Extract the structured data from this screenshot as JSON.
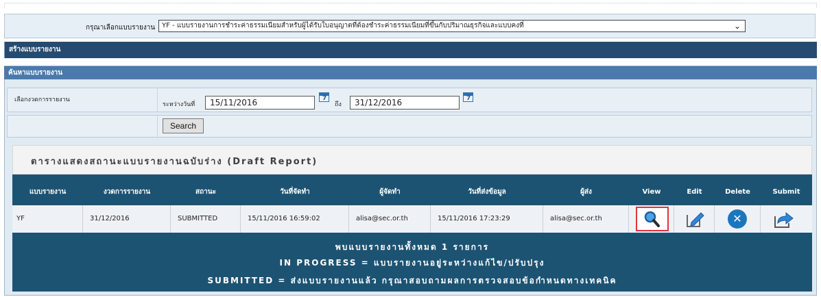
{
  "report_type": {
    "label": "กรุณาเลือกแบบรายงาน",
    "selected": "YF - แบบรายงานการชำระค่าธรรมเนียมสำหรับผู้ได้รับใบอนุญาตที่ต้องชำระค่าธรรมเนียมที่ขึ้นกับปริมาณธุรกิจและแบบคงที่"
  },
  "sections": {
    "create": "สร้างแบบรายงาน",
    "search": "ค้นหาแบบรายงาน"
  },
  "filters": {
    "period_label": "เลือกงวดการรายงาน",
    "between_label": "ระหว่างวันที่",
    "date_from": "15/11/2016",
    "to_label": "ถึง",
    "date_to": "31/12/2016",
    "search_button": "Search"
  },
  "draft_table": {
    "title": "ตารางแสดงสถานะแบบรายงานฉบับร่าง (Draft Report)",
    "columns": [
      "แบบรายงาน",
      "งวดการรายงาน",
      "สถานะ",
      "วันที่จัดทำ",
      "ผู้จัดทำ",
      "วันที่ส่งข้อมูล",
      "ผู้ส่ง",
      "View",
      "Edit",
      "Delete",
      "Submit"
    ],
    "rows": [
      {
        "report": "YF",
        "period": "31/12/2016",
        "status": "SUBMITTED",
        "created_date": "15/11/2016 16:59:02",
        "created_by": "alisa@sec.or.th",
        "submitted_date": "15/11/2016 17:23:29",
        "submitted_by": "alisa@sec.or.th"
      }
    ],
    "summary": "พบแบบรายงานทั้งหมด 1 รายการ",
    "legend_in_progress": "IN PROGRESS = แบบรายงานอยู่ระหว่างแก้ไข/ปรับปรุง",
    "legend_submitted": "SUBMITTED = ส่งแบบรายงานแล้ว กรุณาสอบถามผลการตรวจสอบข้อกำหนดทางเทคนิค"
  },
  "icons": {
    "view": "search-icon",
    "edit": "edit-icon",
    "delete": "delete-icon",
    "submit": "submit-icon",
    "calendar": "calendar-icon"
  },
  "colors": {
    "header_dark": "#264b70",
    "header_light": "#4a79ad",
    "table_bg": "#1c5373",
    "view_highlight": "#e0343a",
    "delete_blue": "#1b77bd"
  }
}
